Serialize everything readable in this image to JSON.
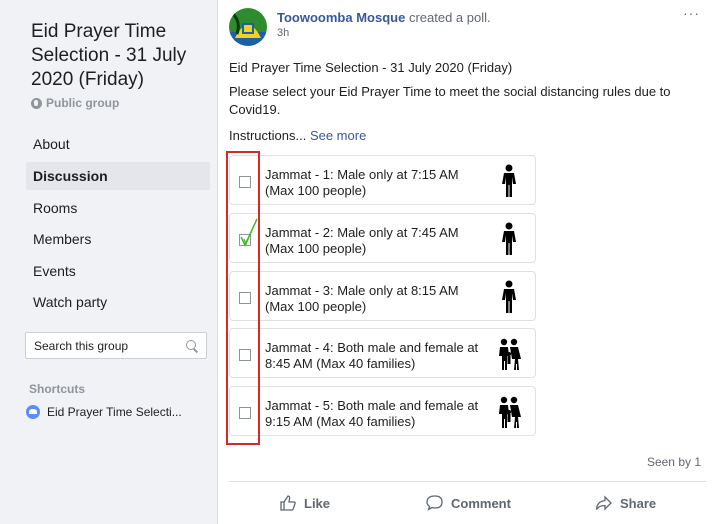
{
  "sidebar": {
    "group_title": "Eid Prayer Time Selection - 31 July 2020 (Friday)",
    "privacy": "Public group",
    "nav": [
      {
        "label": "About"
      },
      {
        "label": "Discussion"
      },
      {
        "label": "Rooms"
      },
      {
        "label": "Members"
      },
      {
        "label": "Events"
      },
      {
        "label": "Watch party"
      }
    ],
    "search_placeholder": "Search this group",
    "shortcuts_heading": "Shortcuts",
    "shortcut_item": "Eid Prayer Time Selecti..."
  },
  "post": {
    "author": "Toowoomba Mosque",
    "action": "created a poll.",
    "time": "3h",
    "more": "···",
    "text_1": "Eid Prayer Time Selection - 31 July 2020 (Friday)",
    "text_2": "Please select your Eid Prayer Time to meet the social distancing rules due to Covid19.",
    "text_3": "Instructions...",
    "see_more": "See more",
    "poll_options": [
      {
        "label": "Jammat - 1: Male only at 7:15 AM (Max 100 people)",
        "checked": false,
        "icon": "male-person-icon"
      },
      {
        "label": "Jammat - 2: Male only at 7:45 AM (Max 100 people)",
        "checked": true,
        "icon": "male-person-icon"
      },
      {
        "label": "Jammat - 3: Male only at 8:15 AM (Max 100 people)",
        "checked": false,
        "icon": "male-person-icon"
      },
      {
        "label": "Jammat - 4: Both male and female at 8:45 AM (Max 40 families)",
        "checked": false,
        "icon": "family-icon"
      },
      {
        "label": "Jammat - 5: Both male and female at 9:15 AM (Max 40 families)",
        "checked": false,
        "icon": "family-icon"
      }
    ],
    "seen_by": "Seen by 1",
    "actions": {
      "like": "Like",
      "comment": "Comment",
      "share": "Share"
    }
  },
  "colors": {
    "link": "#385898",
    "highlight": "#d42a2a",
    "check": "#42b72a"
  }
}
